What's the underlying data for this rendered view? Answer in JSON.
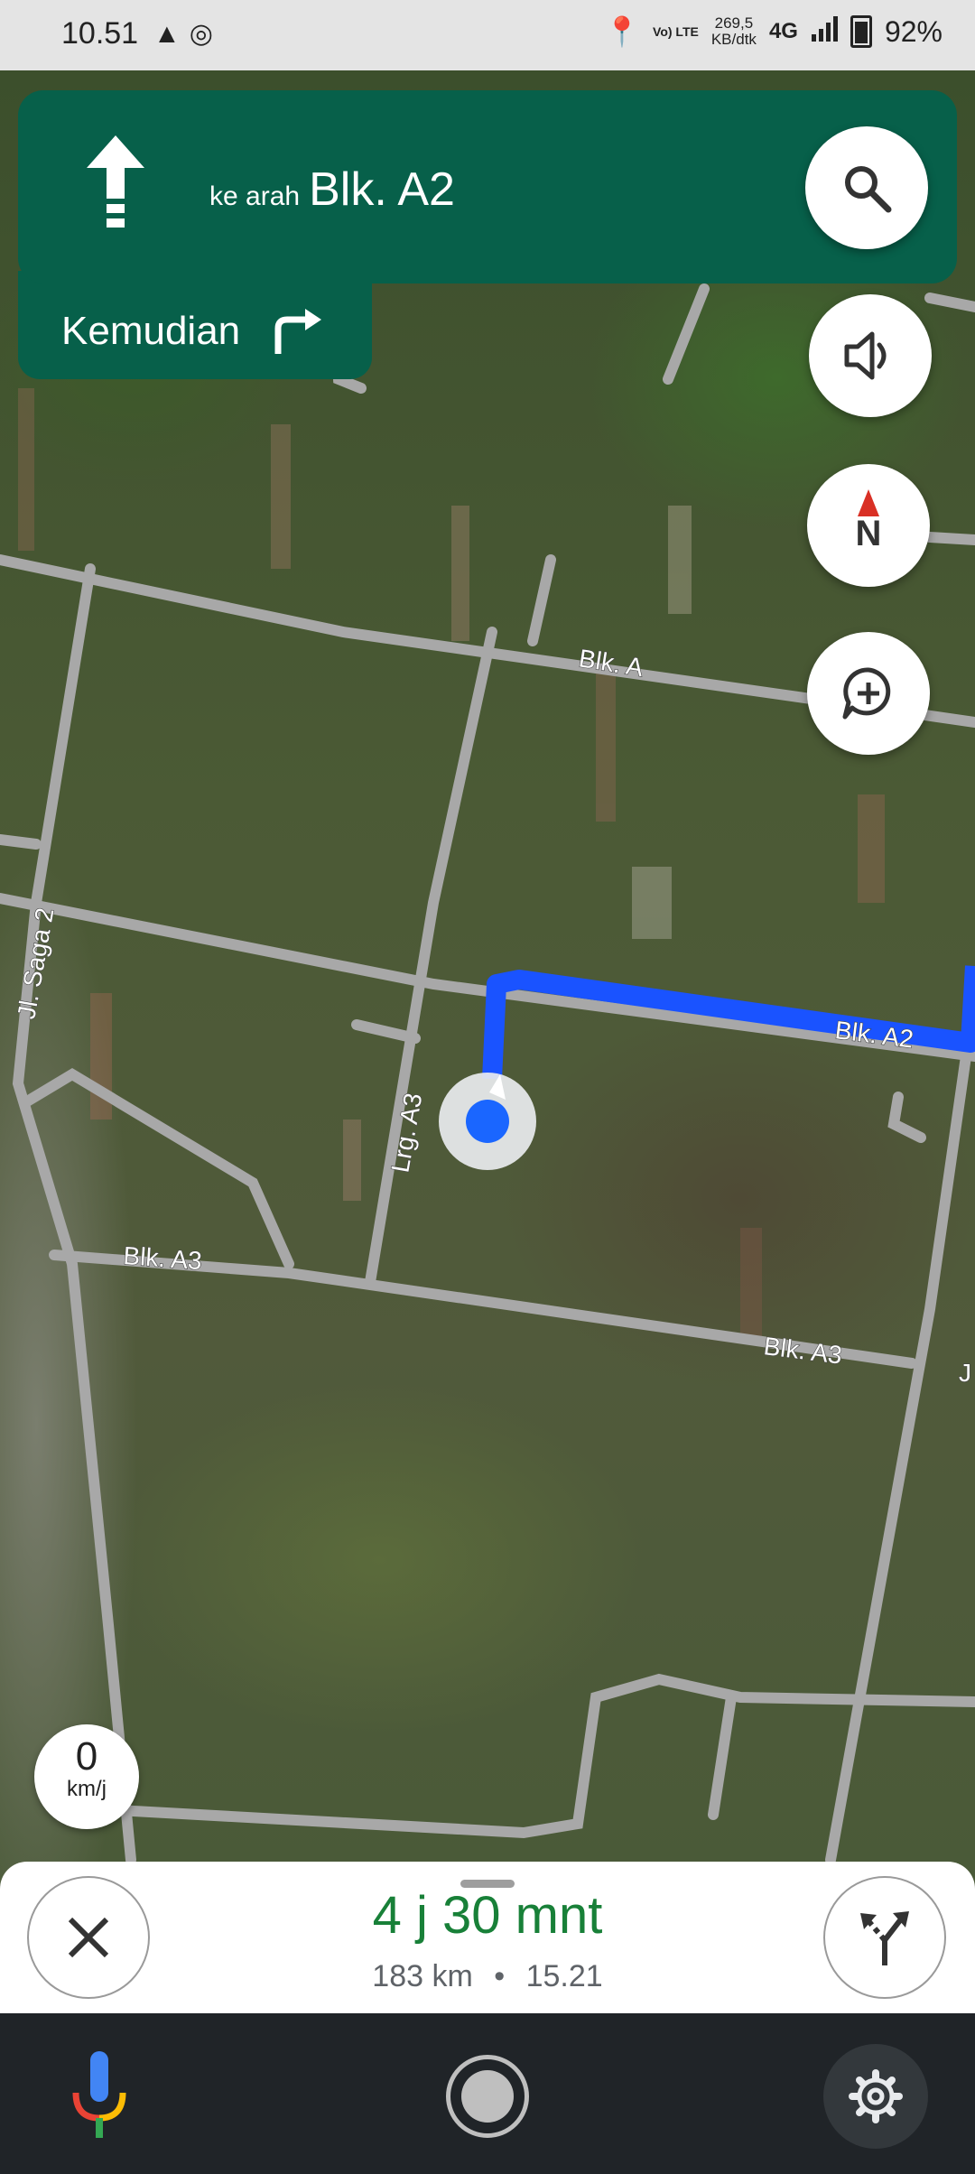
{
  "status_bar": {
    "time": "10.51",
    "left_icons": [
      "navigation-arrow-icon",
      "whatsapp-icon"
    ],
    "volte_lte": "Vo) LTE",
    "data_speed_value": "269,5",
    "data_speed_unit": "KB/dtk",
    "network": "4G",
    "battery_percent": "92%"
  },
  "navigation": {
    "towards_prefix": "ke arah",
    "towards_street": "Blk. A2",
    "then_label": "Kemudian",
    "maneuver_icon": "arrow-up-icon",
    "next_maneuver_icon": "turn-right-icon"
  },
  "map": {
    "labels": {
      "blk_a": "Blk. A",
      "blk_a2": "Blk. A2",
      "blk_a3_left": "Blk. A3",
      "blk_a3_right": "Blk. A3",
      "lrg_a3": "Lrg. A3",
      "jl_saga_2": "Jl. Saga 2",
      "edge_j": "J"
    },
    "route_color": "#1a53ff",
    "road_color": "#a8a8a8"
  },
  "controls": {
    "search_icon": "search-icon",
    "sound_icon": "volume-icon",
    "compass_letter": "N",
    "report_icon": "add-report-icon"
  },
  "speed": {
    "value": "0",
    "unit": "km/j"
  },
  "trip": {
    "eta_hours": "4 j",
    "eta_minutes": "30",
    "eta_minutes_unit": "mnt",
    "distance": "183 km",
    "separator": "•",
    "arrival_time": "15.21"
  },
  "system_nav": {
    "mic_icon": "google-mic-icon",
    "home_icon": "home-button-icon",
    "settings_icon": "gear-icon"
  }
}
